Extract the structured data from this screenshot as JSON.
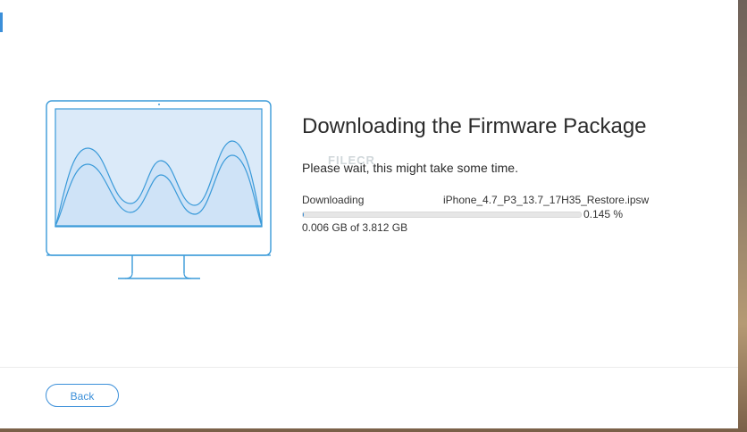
{
  "download": {
    "title": "Downloading the Firmware Package",
    "subtitle": "Please wait, this might take some time.",
    "status_label": "Downloading",
    "filename": "iPhone_4.7_P3_13.7_17H35_Restore.ipsw",
    "progress_percent_text": "0.145 %",
    "progress_fraction": 0.00145,
    "size_text": "0.006 GB of 3.812 GB"
  },
  "footer": {
    "back_label": "Back"
  },
  "watermark": {
    "text": "FILECR"
  },
  "colors": {
    "accent": "#3b8fd9",
    "illustration_stroke": "#3a9ad9",
    "illustration_fill": "#dbeaf9"
  },
  "icons": {
    "illustration": "monitor-waveform-icon"
  }
}
